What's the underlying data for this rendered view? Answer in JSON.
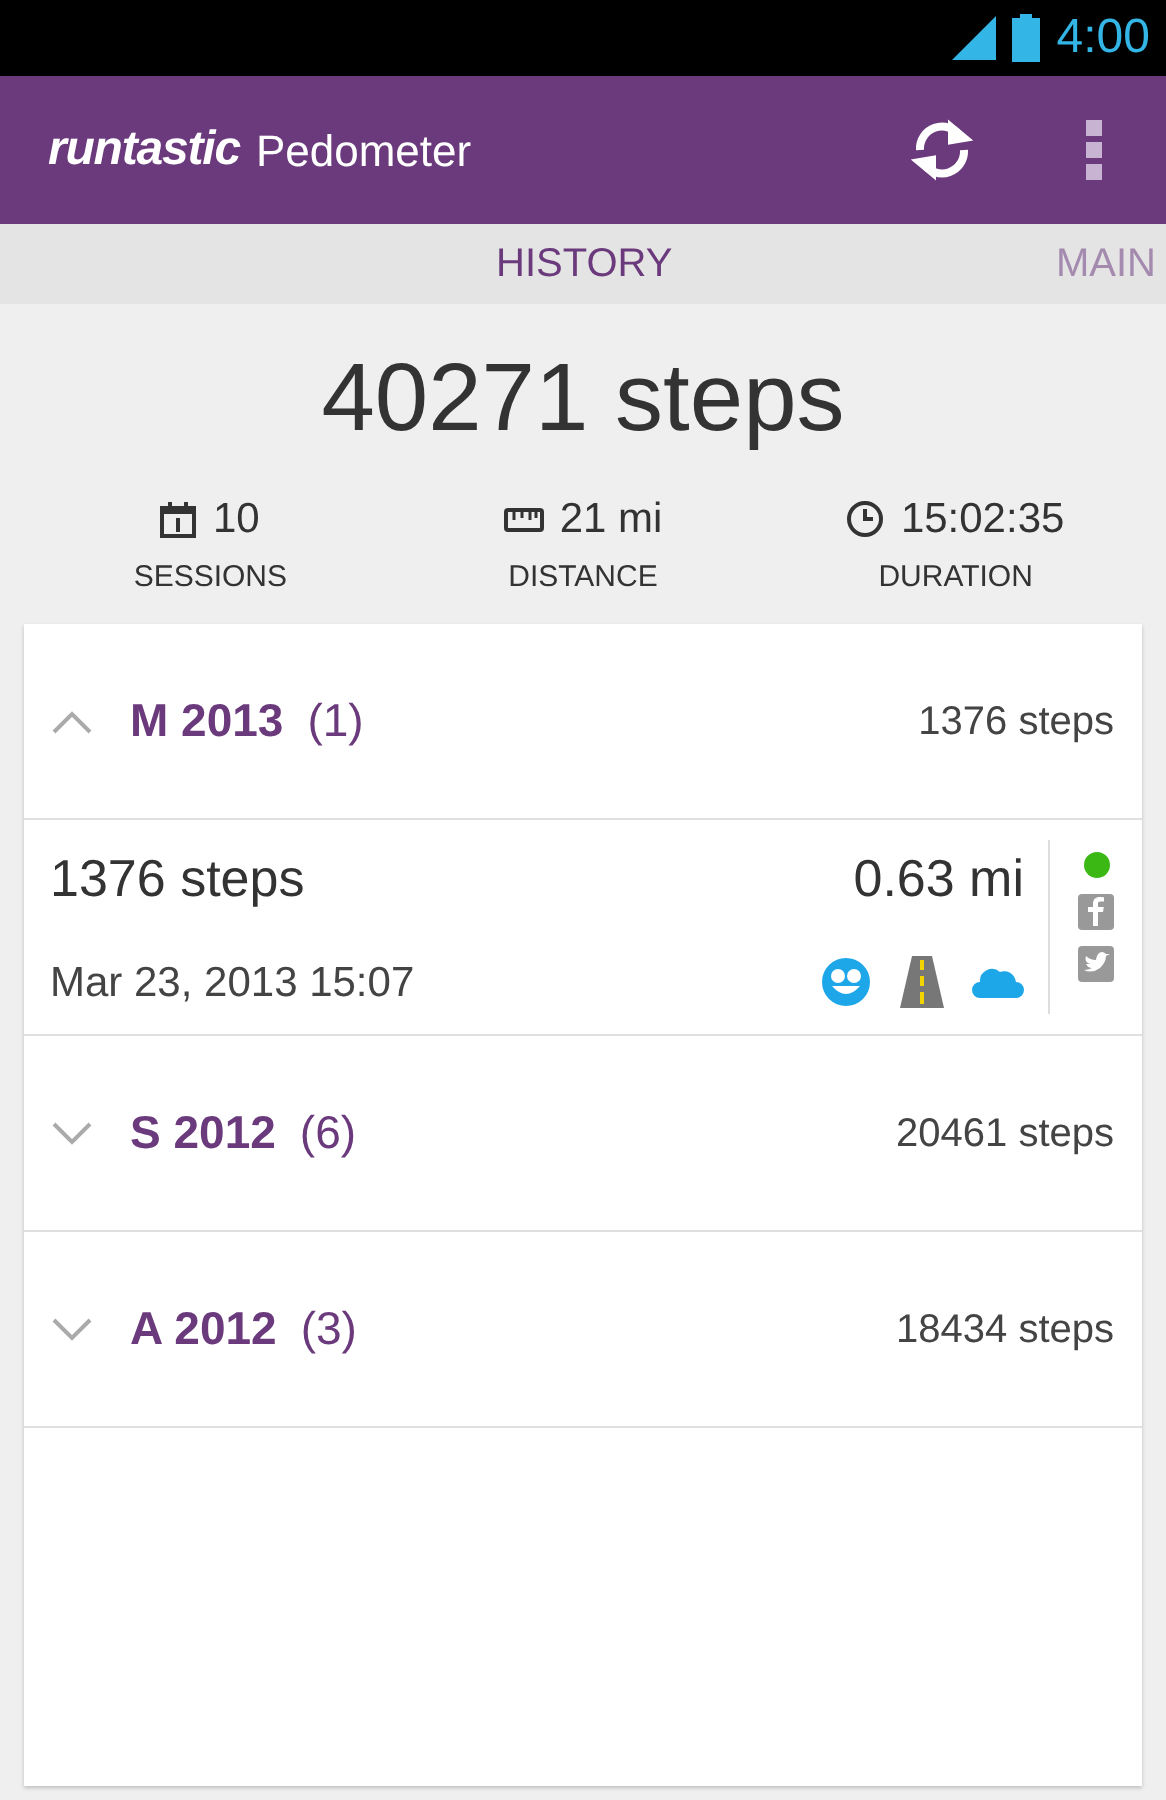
{
  "status_bar": {
    "time": "4:00"
  },
  "app_bar": {
    "logo": "runtastic",
    "title": "Pedometer"
  },
  "tabs": [
    {
      "label": "HISTORY",
      "selected": true
    },
    {
      "label": "MAIN",
      "selected": false
    }
  ],
  "summary": {
    "total": "40271 steps",
    "stats": [
      {
        "kind": "calendar",
        "value": "10",
        "label": "SESSIONS"
      },
      {
        "kind": "ruler",
        "value": "21 mi",
        "label": "DISTANCE"
      },
      {
        "kind": "clock",
        "value": "15:02:35",
        "label": "DURATION"
      }
    ]
  },
  "groups": [
    {
      "title": "M 2013",
      "count": "(1)",
      "steps": "1376 steps",
      "expanded": true,
      "sessions": [
        {
          "steps": "1376 steps",
          "distance": "0.63 mi",
          "date": "Mar 23, 2013 15:07",
          "color": "#3cb815"
        }
      ]
    },
    {
      "title": "S 2012",
      "count": "(6)",
      "steps": "20461 steps",
      "expanded": false
    },
    {
      "title": "A 2012",
      "count": "(3)",
      "steps": "18434 steps",
      "expanded": false
    }
  ]
}
